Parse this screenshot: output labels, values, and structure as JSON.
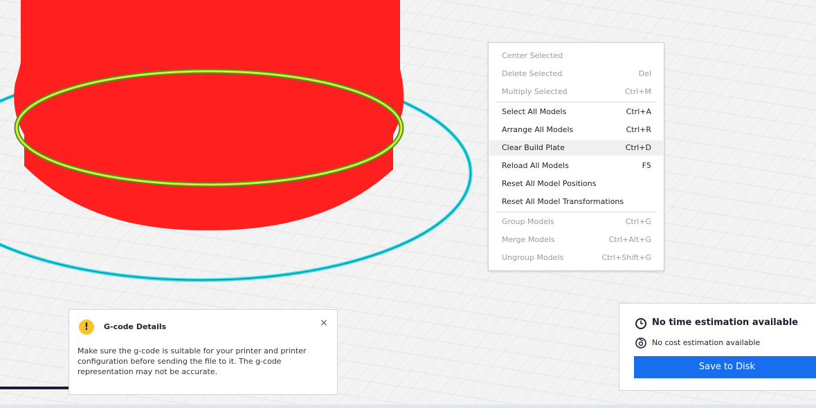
{
  "context_menu": {
    "items": [
      {
        "label": "Center Selected",
        "shortcut": ""
      },
      {
        "label": "Delete Selected",
        "shortcut": "Del"
      },
      {
        "label": "Multiply Selected",
        "shortcut": "Ctrl+M"
      },
      {
        "label": "Select All Models",
        "shortcut": "Ctrl+A"
      },
      {
        "label": "Arrange All Models",
        "shortcut": "Ctrl+R"
      },
      {
        "label": "Clear Build Plate",
        "shortcut": "Ctrl+D"
      },
      {
        "label": "Reload All Models",
        "shortcut": "F5"
      },
      {
        "label": "Reset All Model Positions",
        "shortcut": ""
      },
      {
        "label": "Reset All Model Transformations",
        "shortcut": ""
      },
      {
        "label": "Group Models",
        "shortcut": "Ctrl+G"
      },
      {
        "label": "Merge Models",
        "shortcut": "Ctrl+Alt+G"
      },
      {
        "label": "Ungroup Models",
        "shortcut": "Ctrl+Shift+G"
      }
    ]
  },
  "gcode_panel": {
    "title": "G-code Details",
    "icon": "!",
    "close": "×",
    "body": "Make sure the g-code is suitable for your printer and printer configuration before sending the file to it. The g-code representation may not be accurate."
  },
  "estimate_panel": {
    "time_text": "No time estimation available",
    "cost_text": "No cost estimation available",
    "save_label": "Save to Disk"
  },
  "colors": {
    "model_red": "#ff1f1f",
    "skirt_cyan": "#29dcea",
    "infill_yellow": "#f0e43a",
    "accent_blue": "#196ef0"
  }
}
